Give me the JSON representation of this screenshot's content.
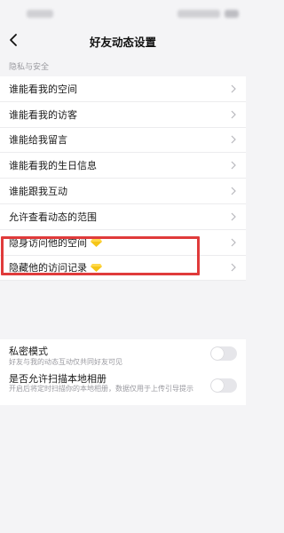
{
  "nav": {
    "title": "好友动态设置"
  },
  "section": {
    "header": "隐私与安全"
  },
  "menu": {
    "items": [
      {
        "label": "谁能看我的空间"
      },
      {
        "label": "谁能看我的访客"
      },
      {
        "label": "谁能给我留言"
      },
      {
        "label": "谁能看我的生日信息"
      },
      {
        "label": "谁能跟我互动"
      },
      {
        "label": "允许查看动态的范围"
      },
      {
        "label": "隐身访问他的空间",
        "badge_icon": "diamond-icon"
      },
      {
        "label": "隐藏他的访问记录",
        "badge_icon": "diamond-icon"
      }
    ]
  },
  "toggles": [
    {
      "title": "私密模式",
      "subtitle": "好友与我的动态互动仅共同好友可见",
      "on": false
    },
    {
      "title": "是否允许扫描本地相册",
      "subtitle": "开启后将定时扫描你的本地相册，数据仅用于上传引导提示",
      "on": false
    }
  ],
  "colors": {
    "highlight": "#e03b3b",
    "diamond": "#f5c518",
    "background": "#f4f4f6"
  }
}
